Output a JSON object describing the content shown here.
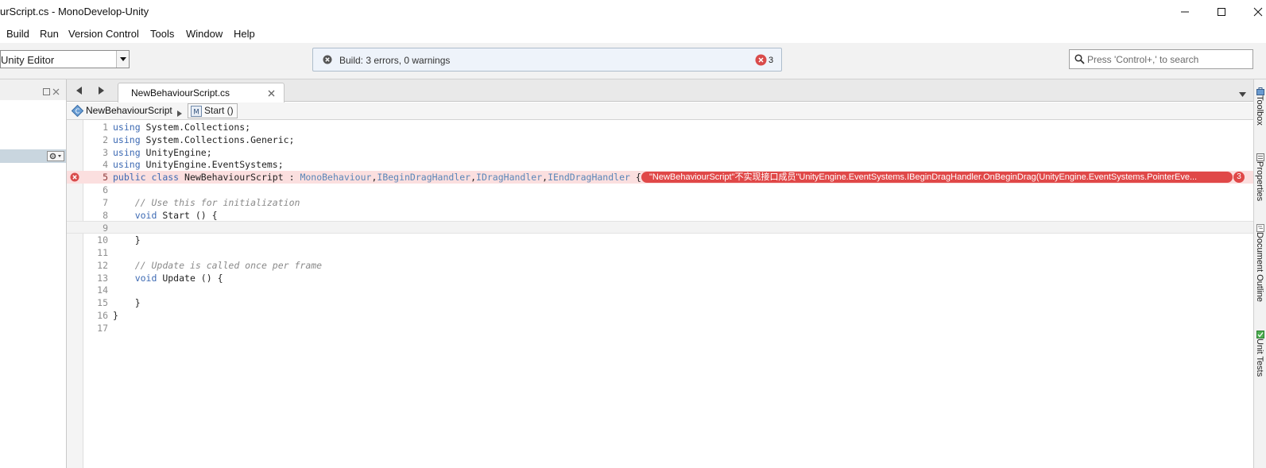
{
  "window": {
    "title": "urScript.cs - MonoDevelop-Unity"
  },
  "menu": {
    "items": [
      "Build",
      "Run",
      "Version Control",
      "Tools",
      "Window",
      "Help"
    ]
  },
  "toolbar": {
    "configuration": "Unity Editor",
    "status_text": "Build: 3 errors, 0 warnings",
    "error_count": "3",
    "search_placeholder": "Press 'Control+,' to search"
  },
  "tabs": [
    {
      "label": "NewBehaviourScript.cs",
      "active": true
    }
  ],
  "pathbar": {
    "class_name": "NewBehaviourScript",
    "method_name": "Start ()"
  },
  "editor": {
    "lines": [
      {
        "n": "1",
        "tokens": [
          [
            "kw",
            "using"
          ],
          [
            "tx",
            " System.Collections;"
          ]
        ]
      },
      {
        "n": "2",
        "tokens": [
          [
            "kw",
            "using"
          ],
          [
            "tx",
            " System.Collections.Generic;"
          ]
        ]
      },
      {
        "n": "3",
        "tokens": [
          [
            "kw",
            "using"
          ],
          [
            "tx",
            " UnityEngine;"
          ]
        ]
      },
      {
        "n": "4",
        "tokens": [
          [
            "kw",
            "using"
          ],
          [
            "tx",
            " UnityEngine.EventSystems;"
          ]
        ]
      },
      {
        "n": "5",
        "tokens": [
          [
            "kw",
            "public"
          ],
          [
            "tx",
            " "
          ],
          [
            "kw",
            "class"
          ],
          [
            "tx",
            " NewBehaviourScript : "
          ],
          [
            "ty",
            "MonoBehaviour"
          ],
          [
            "tx",
            ","
          ],
          [
            "ty",
            "IBeginDragHandler"
          ],
          [
            "tx",
            ","
          ],
          [
            "ty",
            "IDragHandler"
          ],
          [
            "tx",
            ","
          ],
          [
            "ty",
            "IEndDragHandler"
          ],
          [
            "tx",
            " {"
          ]
        ],
        "error": true
      },
      {
        "n": "6",
        "tokens": []
      },
      {
        "n": "7",
        "tokens": [
          [
            "tx",
            "    "
          ],
          [
            "cm",
            "// Use this for initialization"
          ]
        ]
      },
      {
        "n": "8",
        "tokens": [
          [
            "tx",
            "    "
          ],
          [
            "kw",
            "void"
          ],
          [
            "tx",
            " Start () {"
          ]
        ]
      },
      {
        "n": "9",
        "tokens": [],
        "current": true
      },
      {
        "n": "10",
        "tokens": [
          [
            "tx",
            "    }"
          ]
        ]
      },
      {
        "n": "11",
        "tokens": []
      },
      {
        "n": "12",
        "tokens": [
          [
            "tx",
            "    "
          ],
          [
            "cm",
            "// Update is called once per frame"
          ]
        ]
      },
      {
        "n": "13",
        "tokens": [
          [
            "tx",
            "    "
          ],
          [
            "kw",
            "void"
          ],
          [
            "tx",
            " Update () {"
          ]
        ]
      },
      {
        "n": "14",
        "tokens": []
      },
      {
        "n": "15",
        "tokens": [
          [
            "tx",
            "    }"
          ]
        ]
      },
      {
        "n": "16",
        "tokens": [
          [
            "tx",
            "}"
          ]
        ]
      },
      {
        "n": "17",
        "tokens": []
      }
    ],
    "error_message": "\"NewBehaviourScript\"不实现接口成员\"UnityEngine.EventSystems.IBeginDragHandler.OnBeginDrag(UnityEngine.EventSystems.PointerEve...",
    "error_badge": "3"
  },
  "right_dock": {
    "items": [
      "Toolbox",
      "Properties",
      "Document Outline",
      "Unit Tests"
    ]
  },
  "colors": {
    "error": "#e04848",
    "error_line": "#fbdfdf",
    "keyword": "#3d6ab3",
    "comment": "#8a8a8a"
  }
}
